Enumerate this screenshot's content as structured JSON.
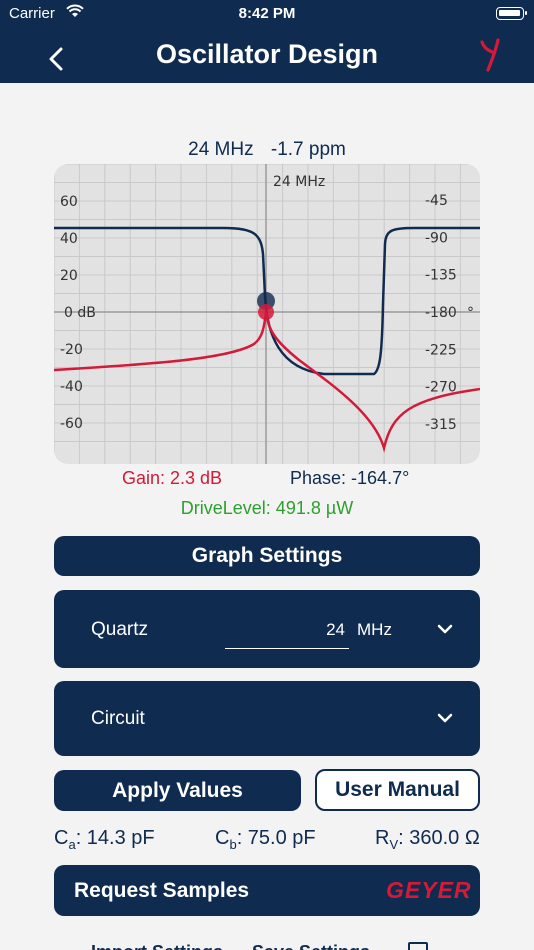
{
  "status_bar": {
    "carrier": "Carrier",
    "time": "8:42 PM"
  },
  "nav": {
    "title": "Oscillator Design"
  },
  "header": {
    "frequency": "24  MHz",
    "deviation": "-1.7 ppm"
  },
  "chart_data": {
    "type": "line",
    "marker_label": "24 MHz",
    "left_axis": {
      "unit": "dB",
      "ticks": [
        "60",
        "40",
        "20",
        "0",
        "-20",
        "-40",
        "-60"
      ],
      "values": [
        60,
        40,
        20,
        0,
        -20,
        -40,
        -60
      ]
    },
    "right_axis": {
      "unit": "°",
      "ticks": [
        "-45",
        "-90",
        "-135",
        "-180",
        "-225",
        "-270",
        "-315"
      ],
      "values": [
        -45,
        -90,
        -135,
        -180,
        -225,
        -270,
        -315
      ]
    },
    "gain_color": "#d31a39",
    "phase_color": "#0f2b4f"
  },
  "readouts": {
    "gain": "Gain: 2.3 dB",
    "phase": "Phase: -164.7°",
    "drive_level": "DriveLevel: 491.8 µW"
  },
  "buttons": {
    "graph_settings": "Graph Settings",
    "apply": "Apply Values",
    "manual": "User Manual",
    "request": "Request Samples"
  },
  "quartz": {
    "label": "Quartz",
    "value": "24",
    "unit": "MHz"
  },
  "circuit": {
    "label": "Circuit"
  },
  "capacitors": {
    "ca_letter": "C",
    "ca_sub": "a",
    "ca_value": ": 14.3 pF",
    "cb_letter": "C",
    "cb_sub": "b",
    "cb_value": ": 75.0 pF",
    "rv_letter": "R",
    "rv_sub": "V",
    "rv_value": ": 360.0 Ω"
  },
  "brand": {
    "logo_text": "GEYER"
  },
  "bottom": {
    "tab1": "Import Settings",
    "tab2": "Save Settings"
  }
}
